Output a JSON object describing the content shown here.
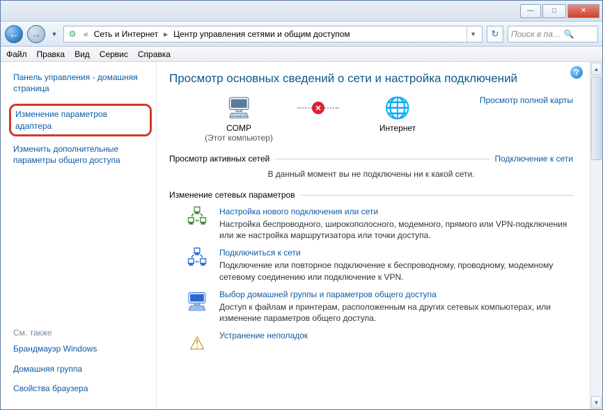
{
  "titlebar": {
    "min_icon": "—",
    "max_icon": "□",
    "close_icon": "✕"
  },
  "nav": {
    "back_icon": "←",
    "fwd_icon": "→",
    "drop_icon": "▼",
    "reload_icon": "↻"
  },
  "breadcrumb": {
    "sep1": "«",
    "part1": "Сеть и Интернет",
    "sep2": "▸",
    "part2": "Центр управления сетями и общим доступом"
  },
  "search": {
    "placeholder": "Поиск в па…",
    "icon": "🔍"
  },
  "menubar": [
    "Файл",
    "Правка",
    "Вид",
    "Сервис",
    "Справка"
  ],
  "sidebar": {
    "home": "Панель управления - домашняя страница",
    "highlighted": "Изменение параметров адаптера",
    "shared": "Изменить дополнительные параметры общего доступа",
    "see_also_hdr": "См. также",
    "see_also": [
      "Брандмауэр Windows",
      "Домашняя группа",
      "Свойства браузера"
    ]
  },
  "main": {
    "title": "Просмотр основных сведений о сети и настройка подключений",
    "map_full_link": "Просмотр полной карты",
    "comp_label": "COMP",
    "comp_sub": "(Этот компьютер)",
    "internet_label": "Интернет",
    "active_nets_hdr": "Просмотр активных сетей",
    "connect_link": "Подключение к сети",
    "no_net_note": "В данный момент вы не подключены ни к какой сети.",
    "change_hdr": "Изменение сетевых параметров",
    "items": [
      {
        "title": "Настройка нового подключения или сети",
        "desc": "Настройка беспроводного, широкополосного, модемного, прямого или VPN-подключения или же настройка маршрутизатора или точки доступа."
      },
      {
        "title": "Подключиться к сети",
        "desc": "Подключение или повторное подключение к беспроводному, проводному, модемному сетевому соединению или подключение к VPN."
      },
      {
        "title": "Выбор домашней группы и параметров общего доступа",
        "desc": "Доступ к файлам и принтерам, расположенным на других сетевых компьютерах, или изменение параметров общего доступа."
      },
      {
        "title": "Устранение неполадок",
        "desc": ""
      }
    ]
  }
}
